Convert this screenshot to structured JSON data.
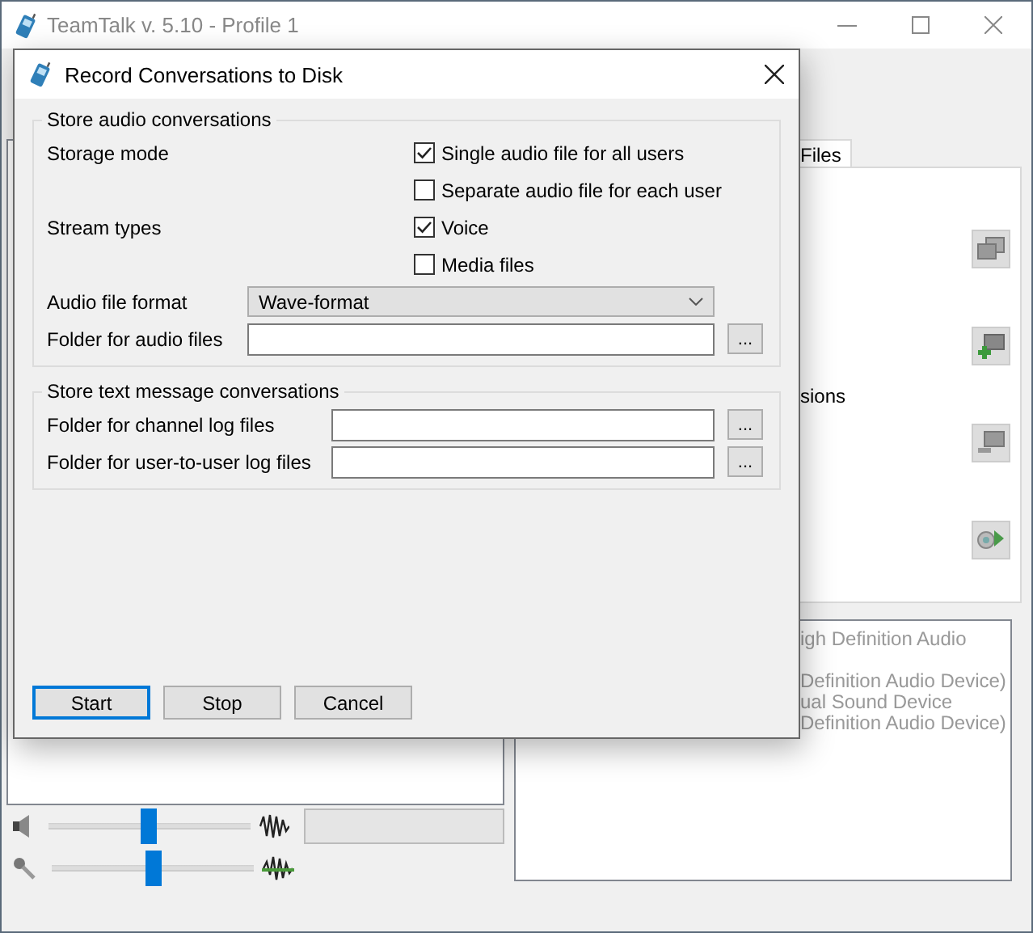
{
  "main_window": {
    "title": "TeamTalk v. 5.10 - Profile 1",
    "tab": {
      "label": "Files",
      "selected": true
    },
    "panel_text": "sions",
    "device_blocks": [
      [
        "igh Definition Audio"
      ],
      [
        "Definition Audio Device)",
        "ual Sound Device",
        "Definition Audio Device)"
      ]
    ],
    "sliders": [
      {
        "kind": "speaker",
        "level": 0.5
      },
      {
        "kind": "microphone",
        "level": 0.5
      }
    ]
  },
  "dialog": {
    "title": "Record Conversations to Disk",
    "groups": [
      {
        "title": "Store audio conversations",
        "kind": "audio",
        "rows": [
          {
            "label": "Storage mode",
            "kind": "checkbox",
            "text": "Single audio file for all users",
            "checked": true
          },
          {
            "kind": "checkbox",
            "text": "Separate audio file for each user",
            "checked": false
          },
          {
            "label": "Stream types",
            "kind": "checkbox",
            "text": "Voice",
            "checked": true
          },
          {
            "kind": "checkbox",
            "text": "Media files",
            "checked": false
          },
          {
            "label": "Audio file format",
            "kind": "combo",
            "value": "Wave-format"
          },
          {
            "label": "Folder for audio files",
            "kind": "path",
            "browse": "..."
          }
        ]
      },
      {
        "title": "Store text message conversations",
        "kind": "text",
        "rows": [
          {
            "label": "Folder for channel log files",
            "kind": "path",
            "browse": "..."
          },
          {
            "label": "Folder for user-to-user log files",
            "kind": "path",
            "browse": "..."
          }
        ]
      }
    ],
    "buttons": [
      {
        "label": "Start",
        "default": true
      },
      {
        "label": "Stop",
        "default": false
      },
      {
        "label": "Cancel",
        "default": false
      }
    ]
  }
}
